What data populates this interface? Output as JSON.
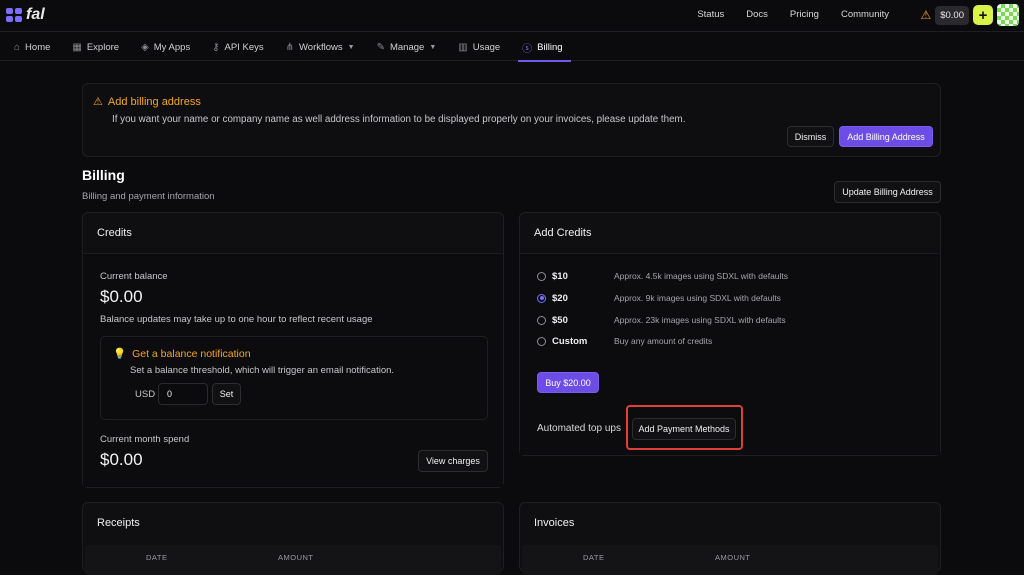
{
  "topbar": {
    "logo_text": "fal",
    "links": [
      "Status",
      "Docs",
      "Pricing",
      "Community"
    ],
    "balance": "$0.00",
    "plus_label": "+"
  },
  "nav": {
    "items": [
      {
        "label": "Home",
        "icon": "home-icon"
      },
      {
        "label": "Explore",
        "icon": "grid-icon"
      },
      {
        "label": "My Apps",
        "icon": "layers-icon"
      },
      {
        "label": "API Keys",
        "icon": "key-icon"
      },
      {
        "label": "Workflows",
        "icon": "workflow-icon",
        "dropdown": true
      },
      {
        "label": "Manage",
        "icon": "wrench-icon",
        "dropdown": true
      },
      {
        "label": "Usage",
        "icon": "chart-icon"
      },
      {
        "label": "Billing",
        "icon": "dollar-circle-icon",
        "active": true
      }
    ]
  },
  "alert": {
    "title": "Add billing address",
    "text": "If you want your name or company name as well address information to be displayed properly on your invoices, please update them.",
    "dismiss_label": "Dismiss",
    "add_label": "Add Billing Address"
  },
  "page": {
    "title": "Billing",
    "subtitle": "Billing and payment information",
    "update_label": "Update Billing Address"
  },
  "credits": {
    "title": "Credits",
    "balance_label": "Current balance",
    "balance_value": "$0.00",
    "balance_note": "Balance updates may take up to one hour to reflect recent usage",
    "notif_title": "Get a balance notification",
    "notif_text": "Set a balance threshold, which will trigger an email notification.",
    "currency": "USD",
    "threshold_value": "0",
    "set_label": "Set",
    "month_label": "Current month spend",
    "month_value": "$0.00",
    "view_charges_label": "View charges"
  },
  "add_credits": {
    "title": "Add Credits",
    "options": [
      {
        "label": "$10",
        "desc": "Approx. 4.5k images using SDXL with defaults",
        "selected": false
      },
      {
        "label": "$20",
        "desc": "Approx. 9k images using SDXL with defaults",
        "selected": true
      },
      {
        "label": "$50",
        "desc": "Approx. 23k images using SDXL with defaults",
        "selected": false
      },
      {
        "label": "Custom",
        "desc": "Buy any amount of credits",
        "selected": false
      }
    ],
    "buy_label": "Buy $20.00",
    "auto_label": "Automated top ups",
    "payment_label": "Add Payment Methods"
  },
  "receipts": {
    "title": "Receipts",
    "columns": [
      "DATE",
      "AMOUNT"
    ]
  },
  "invoices": {
    "title": "Invoices",
    "columns": [
      "DATE",
      "AMOUNT"
    ]
  },
  "colors": {
    "accent": "#6c4ee6",
    "warning": "#f5a524",
    "highlight": "#e0403c"
  }
}
